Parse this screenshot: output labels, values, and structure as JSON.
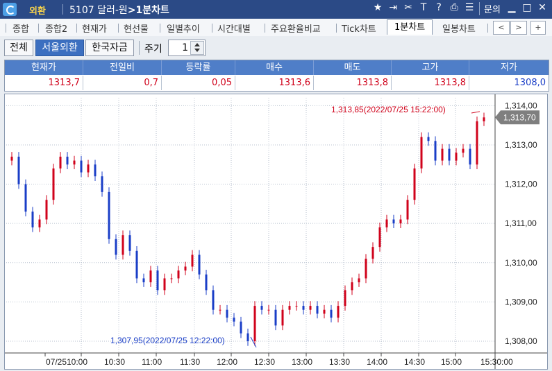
{
  "titlebar": {
    "menu_name": "외환",
    "code": "5107 달러-원",
    "screen_name": ">1분차트",
    "help": "문의"
  },
  "tabs": [
    {
      "label": "종합",
      "active": false
    },
    {
      "label": "종합2",
      "active": false
    },
    {
      "label": "현재가",
      "active": false
    },
    {
      "label": "현선물",
      "active": false
    },
    {
      "label": "일별추이",
      "active": false
    },
    {
      "label": "시간대별",
      "active": false
    },
    {
      "label": "주요환율비교",
      "active": false
    },
    {
      "label": "Tick차트",
      "active": false
    },
    {
      "label": "1분차트",
      "active": true
    },
    {
      "label": "일봉차트",
      "active": false
    }
  ],
  "tab_nav": {
    "prev": "<",
    "next": ">",
    "add": "+"
  },
  "filters": {
    "all": "전체",
    "seoul": "서울외환",
    "korea_money": "한국자금",
    "cycle_label": "주기",
    "cycle_value": "1"
  },
  "quote": {
    "headers": [
      "현재가",
      "전일비",
      "등락률",
      "매수",
      "매도",
      "고가",
      "저가"
    ],
    "values": [
      "1313,7",
      "0,7",
      "0,05",
      "1313,6",
      "1313,8",
      "1313,8",
      "1308,0"
    ]
  },
  "colors": {
    "title_bg": "#2b4a86",
    "header_bg": "#4f7ec8",
    "up": "#d0021b",
    "down": "#1a3ec7",
    "current_tag": "#7f7f7f"
  },
  "chart_data": {
    "type": "candlestick",
    "y_ticks": [
      "1,314,00",
      "1,313,00",
      "1,312,00",
      "1,311,00",
      "1,310,00",
      "1,309,00",
      "1,308,00"
    ],
    "y_tick_values": [
      1314,
      1313,
      1312,
      1311,
      1310,
      1309,
      1308
    ],
    "ylim": [
      1307.7,
      1314.2
    ],
    "x_ticks": [
      "07/25",
      "10:00",
      "10:30",
      "11:00",
      "11:30",
      "12:00",
      "12:30",
      "13:00",
      "13:30",
      "14:00",
      "14:30",
      "15:00",
      "15:30:00"
    ],
    "current_price_label": "1,313,70",
    "current_price": 1313.7,
    "high_annotation": "1,313,85(2022/07/25 15:22:00)",
    "high_value": 1313.85,
    "low_annotation": "1,307,95(2022/07/25 12:22:00)",
    "low_value": 1307.95,
    "closes": [
      1312.7,
      1312.0,
      1311.3,
      1310.9,
      1311.1,
      1311.6,
      1312.4,
      1312.7,
      1312.5,
      1312.6,
      1312.3,
      1312.5,
      1312.2,
      1311.8,
      1310.6,
      1310.2,
      1310.7,
      1310.3,
      1309.6,
      1309.5,
      1309.8,
      1309.3,
      1309.6,
      1309.6,
      1309.8,
      1309.9,
      1310.2,
      1309.7,
      1309.3,
      1308.8,
      1308.8,
      1308.6,
      1308.5,
      1308.2,
      1308.0,
      1308.9,
      1308.8,
      1308.8,
      1308.4,
      1308.8,
      1308.9,
      1308.9,
      1308.8,
      1308.9,
      1308.7,
      1308.8,
      1308.6,
      1308.9,
      1309.3,
      1309.5,
      1309.6,
      1310.1,
      1310.4,
      1310.9,
      1311.1,
      1311.0,
      1311.1,
      1311.6,
      1312.4,
      1313.2,
      1313.1,
      1312.6,
      1312.9,
      1312.6,
      1312.8,
      1312.9,
      1312.5,
      1313.6,
      1313.7
    ]
  }
}
